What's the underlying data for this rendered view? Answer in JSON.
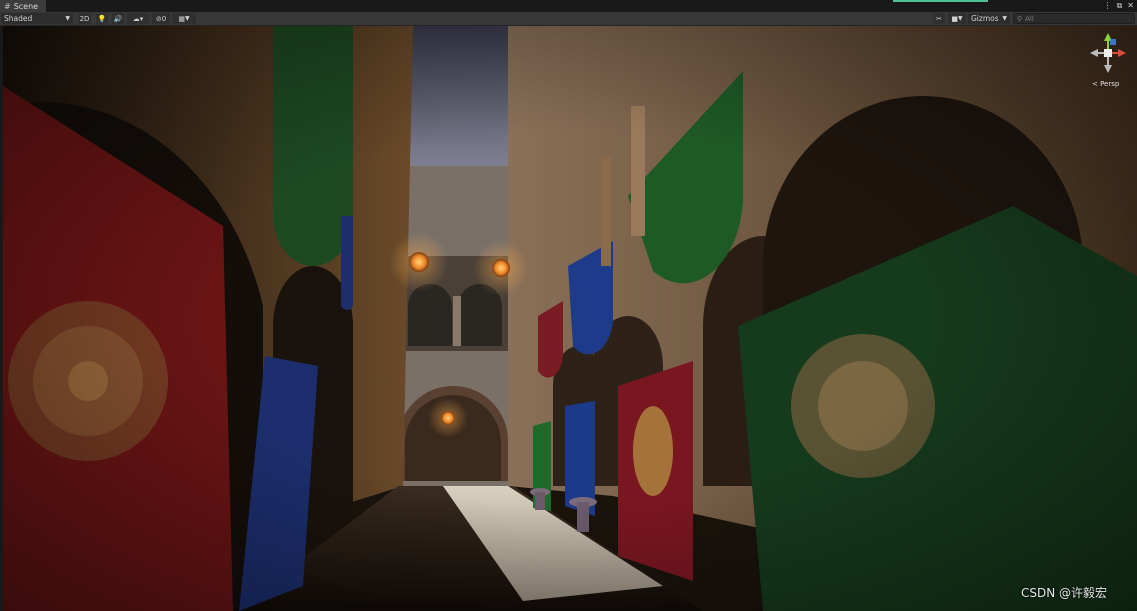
{
  "window": {
    "tab_icon": "grid-icon",
    "tab_label": "Scene",
    "controls": [
      "⋮",
      "⧉",
      "✕"
    ]
  },
  "toolbar": {
    "shading_mode": "Shaded",
    "btn_2d": "2D",
    "btn_lighting": "lighting-icon",
    "btn_audio": "audio-icon",
    "btn_effects": "effects-icon",
    "btn_hidden_count": "0",
    "btn_grid": "grid-icon",
    "btn_tools": "tools-icon",
    "btn_camera": "camera-icon",
    "gizmos_label": "Gizmos",
    "search_placeholder": "All",
    "search_icon": "search-icon"
  },
  "viewport": {
    "description": "3D scene view",
    "perspective_label": "< Persp"
  },
  "gizmo": {
    "axes": [
      "x",
      "y",
      "z"
    ],
    "colors": {
      "x": "#e0483c",
      "y": "#8cd23a",
      "z": "#3d7de0"
    }
  },
  "watermark": "CSDN @许毅宏"
}
